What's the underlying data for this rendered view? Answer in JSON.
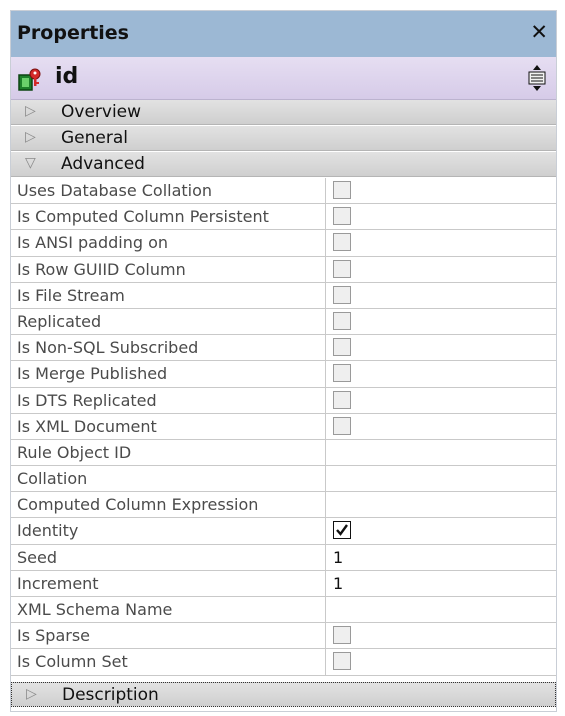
{
  "panel": {
    "title": "Properties",
    "close_glyph": "✕",
    "object_name": "id",
    "object_icon": "column-key-icon",
    "sort_icon": "categorize-icon"
  },
  "categories": {
    "overview": "Overview",
    "general": "General",
    "advanced": "Advanced",
    "description": "Description"
  },
  "rows": [
    {
      "label": "Uses Database Collation",
      "type": "checkbox",
      "checked": false
    },
    {
      "label": "Is Computed Column Persistent",
      "type": "checkbox",
      "checked": false
    },
    {
      "label": "Is ANSI padding on",
      "type": "checkbox",
      "checked": false
    },
    {
      "label": "Is Row GUIID Column",
      "type": "checkbox",
      "checked": false
    },
    {
      "label": "Is File Stream",
      "type": "checkbox",
      "checked": false
    },
    {
      "label": "Replicated",
      "type": "checkbox",
      "checked": false
    },
    {
      "label": "Is Non-SQL Subscribed",
      "type": "checkbox",
      "checked": false
    },
    {
      "label": "Is Merge Published",
      "type": "checkbox",
      "checked": false
    },
    {
      "label": "Is DTS Replicated",
      "type": "checkbox",
      "checked": false
    },
    {
      "label": "Is XML Document",
      "type": "checkbox",
      "checked": false
    },
    {
      "label": "Rule Object ID",
      "type": "text",
      "value": ""
    },
    {
      "label": "Collation",
      "type": "text",
      "value": ""
    },
    {
      "label": "Computed Column Expression",
      "type": "text",
      "value": ""
    },
    {
      "label": "Identity",
      "type": "checkbox",
      "checked": true
    },
    {
      "label": "Seed",
      "type": "text",
      "value": "1"
    },
    {
      "label": "Increment",
      "type": "text",
      "value": "1"
    },
    {
      "label": "XML Schema Name",
      "type": "text",
      "value": ""
    },
    {
      "label": "Is Sparse",
      "type": "checkbox",
      "checked": false
    },
    {
      "label": "Is Column Set",
      "type": "checkbox",
      "checked": false
    }
  ],
  "colors": {
    "titlebar": "#9cb8d4",
    "object_row": "#ddd4ec",
    "category_bar": "#d8d8d8"
  }
}
